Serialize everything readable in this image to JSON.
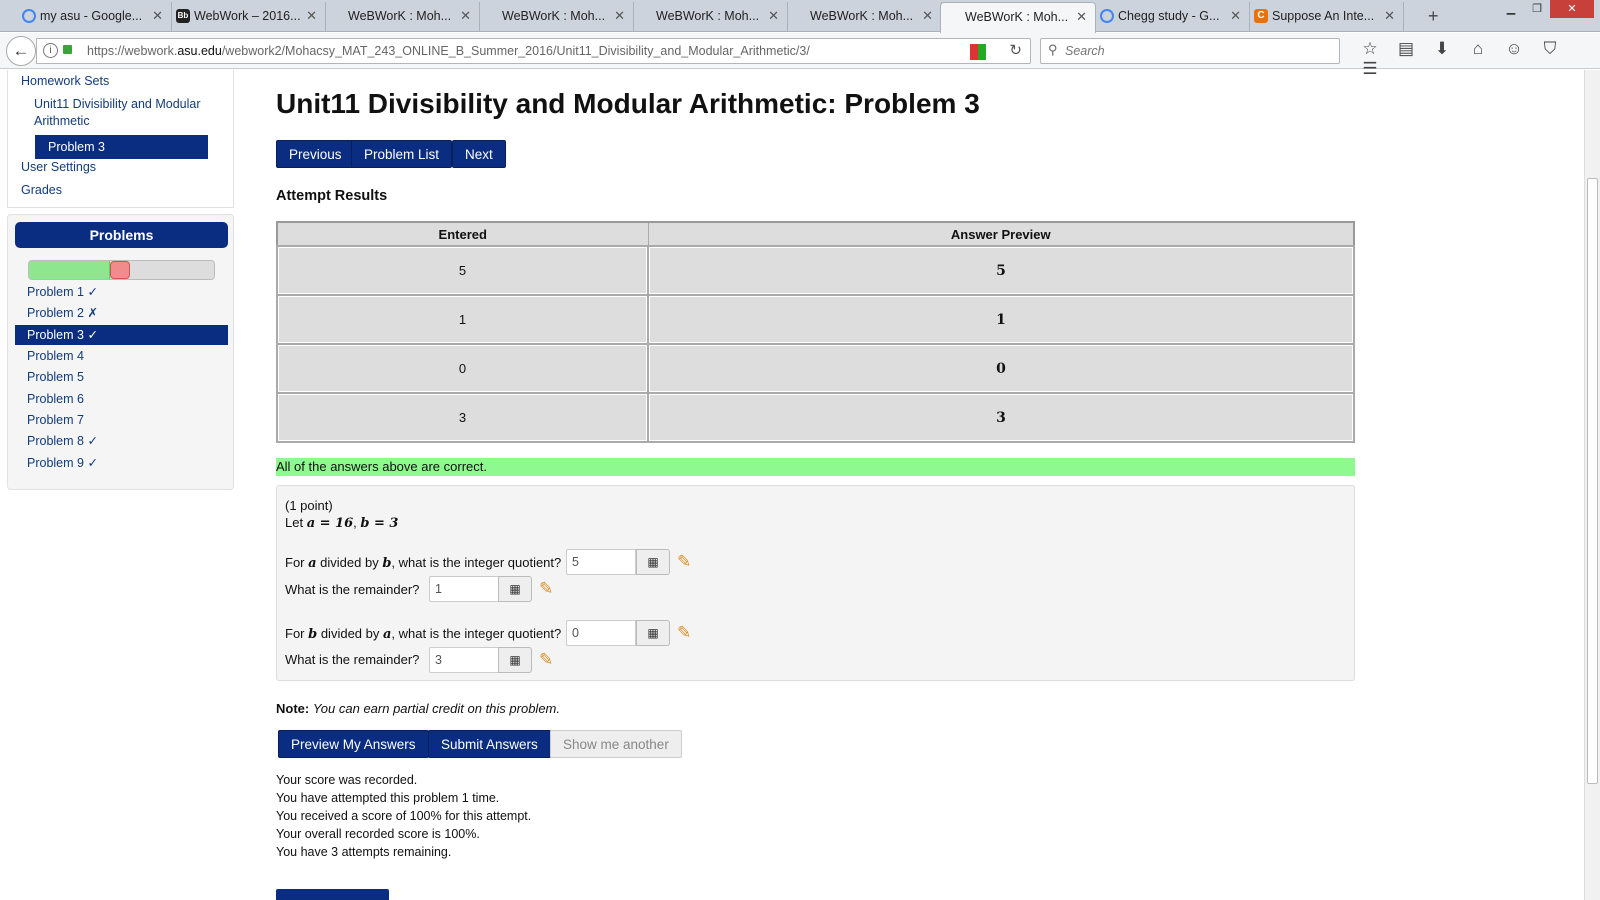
{
  "browser": {
    "tabs": [
      {
        "label": "my asu - Google...",
        "icon": "google-icon"
      },
      {
        "label": "WebWork – 2016...",
        "icon": "blackboard-icon"
      },
      {
        "label": "WeBWorK : Moh...",
        "icon": "none"
      },
      {
        "label": "WeBWorK : Moh...",
        "icon": "none"
      },
      {
        "label": "WeBWorK : Moh...",
        "icon": "none"
      },
      {
        "label": "WeBWorK : Moh...",
        "icon": "none"
      },
      {
        "label": "WeBWorK : Moh...",
        "icon": "none",
        "active": true
      },
      {
        "label": "Chegg study - G...",
        "icon": "google-icon"
      },
      {
        "label": "Suppose An Inte...",
        "icon": "chegg-icon"
      }
    ],
    "url_prefix": "https://webwork.",
    "url_domain": "asu.edu",
    "url_path": "/webwork2/Mohacsy_MAT_243_ONLINE_B_Summer_2016/Unit11_Divisibility_and_Modular_Arithmetic/3/",
    "search_placeholder": "Search"
  },
  "sidebar": {
    "homework_sets": "Homework Sets",
    "unit_line1": "Unit11 Divisibility and Modular",
    "unit_line2": "Arithmetic",
    "current_problem": "Problem 3",
    "user_settings": "User Settings",
    "grades": "Grades",
    "problems_header": "Problems",
    "progress_correct_fraction": 0.44,
    "problems": [
      {
        "label": "Problem 1 ✓"
      },
      {
        "label": "Problem 2 ✗"
      },
      {
        "label": "Problem 3 ✓",
        "active": true
      },
      {
        "label": "Problem 4"
      },
      {
        "label": "Problem 5"
      },
      {
        "label": "Problem 6"
      },
      {
        "label": "Problem 7"
      },
      {
        "label": "Problem 8 ✓"
      },
      {
        "label": "Problem 9 ✓"
      }
    ]
  },
  "main": {
    "title": "Unit11 Divisibility and Modular Arithmetic: Problem 3",
    "nav": {
      "previous": "Previous",
      "list": "Problem List",
      "next": "Next"
    },
    "attempt_heading": "Attempt Results",
    "results_headers": [
      "Entered",
      "Answer Preview"
    ],
    "results_rows": [
      {
        "entered": "5",
        "preview": "5"
      },
      {
        "entered": "1",
        "preview": "1"
      },
      {
        "entered": "0",
        "preview": "0"
      },
      {
        "entered": "3",
        "preview": "3"
      }
    ],
    "correct_msg": "All of the answers above are correct.",
    "problem": {
      "points": "(1 point)",
      "let_prefix": "Let ",
      "let_a": "a = 16",
      "let_sep": ", ",
      "let_b": "b = 3",
      "q1_pre": "For ",
      "q1_var1": "a",
      "q1_mid": " divided by ",
      "q1_var2": "b",
      "q1_post": ", what is the integer quotient?",
      "q1_value": "5",
      "r1_label": "What is the remainder?",
      "r1_value": "1",
      "q2_pre": "For ",
      "q2_var1": "b",
      "q2_mid": " divided by ",
      "q2_var2": "a",
      "q2_post": ", what is the integer quotient?",
      "q2_value": "0",
      "r2_label": "What is the remainder?",
      "r2_value": "3"
    },
    "note_label": "Note:",
    "note_text": "You can earn partial credit on this problem.",
    "buttons": {
      "preview": "Preview My Answers",
      "submit": "Submit Answers",
      "another": "Show me another"
    },
    "score_lines": [
      "Your score was recorded.",
      "You have attempted this problem 1 time.",
      "You received a score of 100% for this attempt.",
      "Your overall recorded score is 100%.",
      "You have 3 attempts remaining."
    ]
  },
  "colors": {
    "primary": "#0a2d82",
    "success": "#8ef98e",
    "progress_good": "#8ee68e",
    "progress_current": "#f28b8b"
  }
}
